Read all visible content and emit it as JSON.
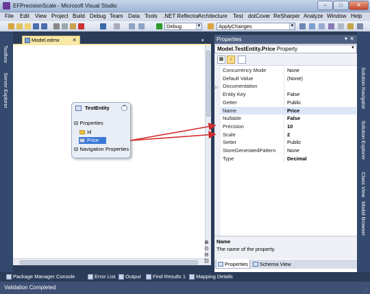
{
  "window": {
    "title": "EFPrecisionScale - Microsoft Visual Studio",
    "min": "–",
    "max": "□",
    "close": "✕"
  },
  "menu": [
    "File",
    "Edit",
    "View",
    "Project",
    "Build",
    "Debug",
    "Team",
    "Data",
    "Tools",
    ".NET Reflector",
    "Architecture",
    "Test",
    "dotCover",
    "ReSharper",
    "Analyze",
    "Window",
    "Help"
  ],
  "toolbar": {
    "config": "Debug",
    "target": "ApplyChanges"
  },
  "left_tabs": [
    "Toolbox",
    "Server Explorer"
  ],
  "right_tabs": [
    "Solution Navigator",
    "Solution Explorer",
    "Class View",
    "Model Browser"
  ],
  "document": {
    "tab_title": "Model.edmx",
    "entity": {
      "name": "TestEntity",
      "properties_label": "Properties",
      "properties": [
        "Id",
        "Price"
      ],
      "navigation_label": "Navigation Properties"
    }
  },
  "properties_panel": {
    "title": "Properties",
    "selector_object": "Model.TestEntity.Price",
    "selector_type": "Property",
    "rows": [
      {
        "name": "Concurrency Mode",
        "value": "None",
        "bold": false
      },
      {
        "name": "Default Value",
        "value": "(None)",
        "bold": false
      },
      {
        "name": "Documentation",
        "value": "",
        "bold": false
      },
      {
        "name": "Entity Key",
        "value": "False",
        "bold": false
      },
      {
        "name": "Getter",
        "value": "Public",
        "bold": false
      },
      {
        "name": "Name",
        "value": "Price",
        "bold": true
      },
      {
        "name": "Nullable",
        "value": "False",
        "bold": true
      },
      {
        "name": "Precision",
        "value": "10",
        "bold": true
      },
      {
        "name": "Scale",
        "value": "2",
        "bold": true
      },
      {
        "name": "Setter",
        "value": "Public",
        "bold": false
      },
      {
        "name": "StoreGeneratedPattern",
        "value": "None",
        "bold": false
      },
      {
        "name": "Type",
        "value": "Decimal",
        "bold": true
      }
    ],
    "description_title": "Name",
    "description_text": "The name of the property.",
    "tabs": [
      "Properties",
      "Schema View"
    ]
  },
  "bottom_tabs": [
    "Package Manager Console",
    "Error List",
    "Output",
    "Find Results 1",
    "Mapping Details"
  ],
  "status": "Validation Completed",
  "colors": {
    "accent_arrow": "#d22a2a",
    "selection": "#3b78d6",
    "doc_tab": "#f9e9a7"
  }
}
